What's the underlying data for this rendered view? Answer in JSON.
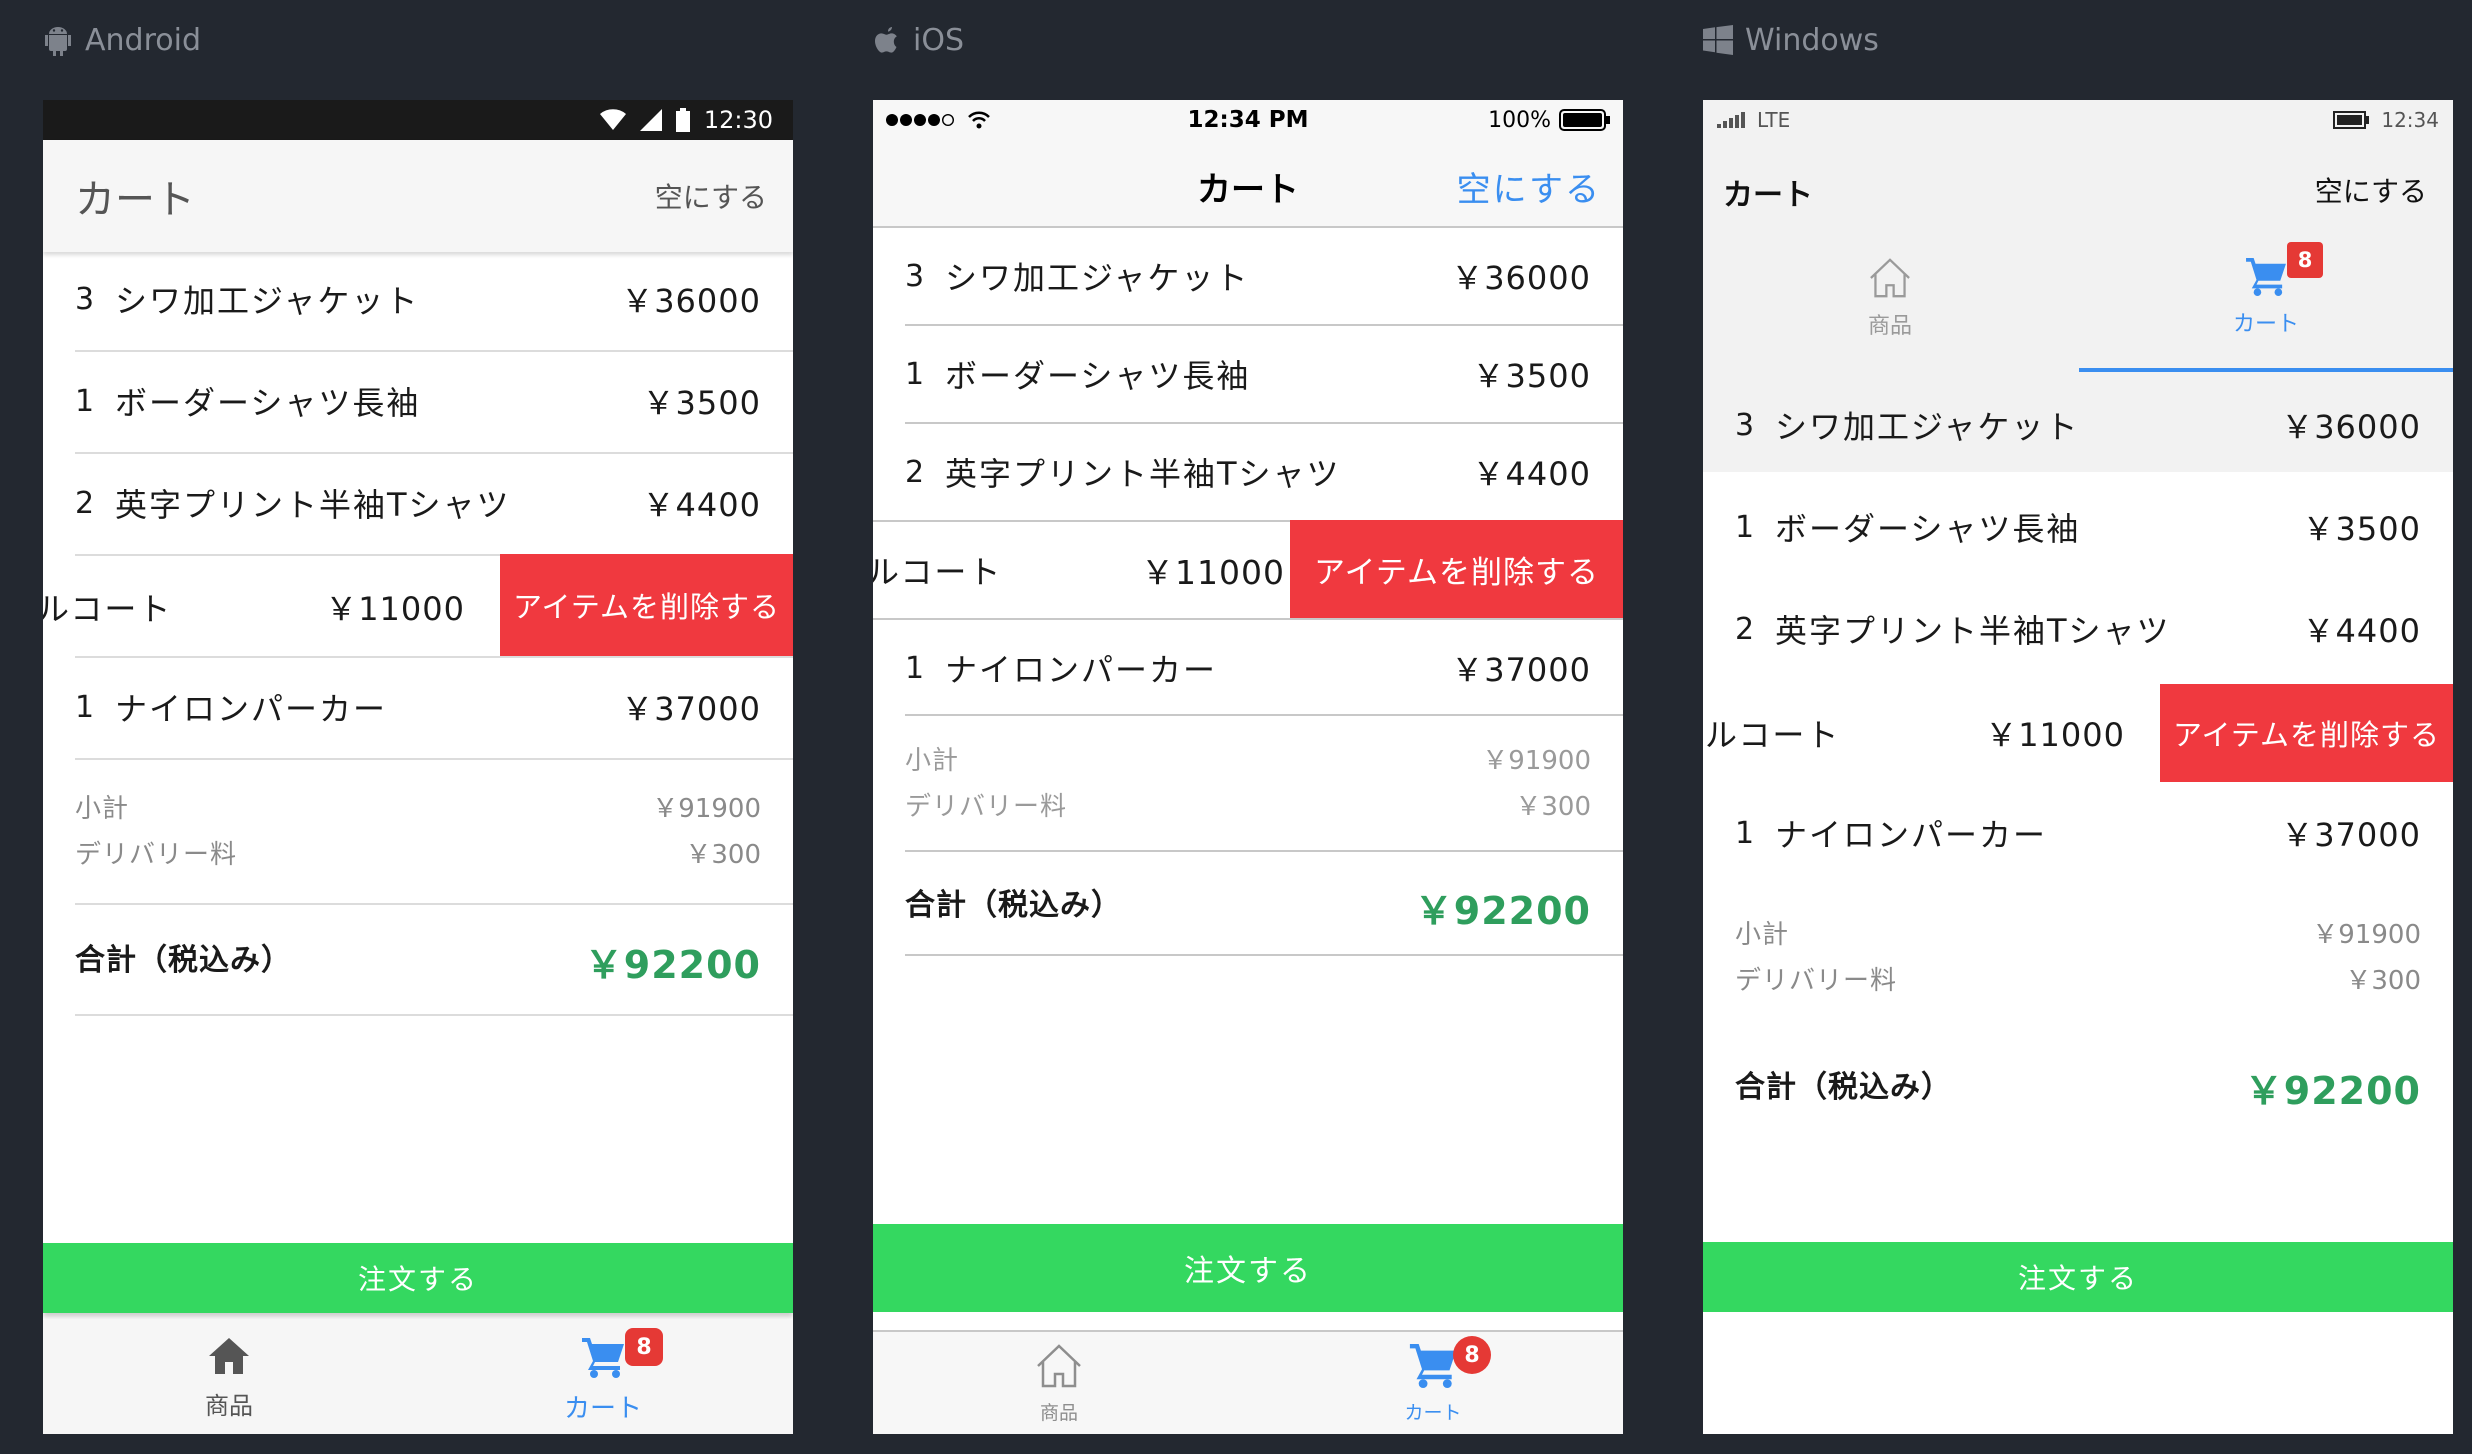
{
  "platforms": {
    "android": "Android",
    "ios": "iOS",
    "windows": "Windows"
  },
  "android": {
    "status_time": "12:30",
    "title": "カート",
    "clear": "空にする",
    "order": "注文する",
    "tabs": {
      "products": "商品",
      "cart": "カート"
    },
    "badge": "8"
  },
  "ios": {
    "status_time": "12:34 PM",
    "battery": "100%",
    "title": "カート",
    "clear": "空にする",
    "order": "注文する",
    "tabs": {
      "products": "商品",
      "cart": "カート"
    },
    "badge": "8"
  },
  "windows": {
    "status_network": "LTE",
    "status_time": "12:34",
    "title": "カート",
    "clear": "空にする",
    "order": "注文する",
    "tabs": {
      "products": "商品",
      "cart": "カート"
    },
    "badge": "8"
  },
  "cart": {
    "items": [
      {
        "qty": "3",
        "name": "シワ加工ジャケット",
        "price": "￥36000"
      },
      {
        "qty": "1",
        "name": "ボーダーシャツ長袖",
        "price": "￥3500"
      },
      {
        "qty": "2",
        "name": "英字プリント半袖Tシャツ",
        "price": "￥4400"
      },
      {
        "qty": "",
        "name": "ルコート",
        "price": "￥11000"
      },
      {
        "qty": "1",
        "name": "ナイロンパーカー",
        "price": "￥37000"
      }
    ],
    "delete_label": "アイテムを削除する",
    "subtotal_label": "小計",
    "subtotal_value": "￥91900",
    "delivery_label": "デリバリー料",
    "delivery_value": "￥300",
    "total_label": "合計（税込み）",
    "total_value": "￥92200"
  },
  "colors": {
    "background": "#232830",
    "accent_blue": "#3a8ef0",
    "delete_red": "#f0393f",
    "order_green": "#34d860",
    "total_green": "#2f9e5d",
    "badge_red": "#e53935"
  }
}
